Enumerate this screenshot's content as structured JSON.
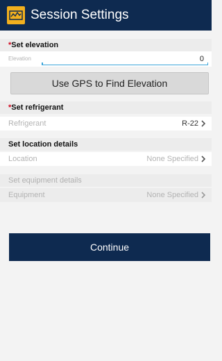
{
  "app": {
    "title": "Session Settings",
    "logo_icon": "app-logo-icon"
  },
  "sections": {
    "elevation": {
      "required_mark": "*",
      "header": "Set elevation",
      "field_label": "Elevation",
      "field_value": "0"
    },
    "gps_button_label": "Use GPS to Find Elevation",
    "refrigerant": {
      "required_mark": "*",
      "header": "Set refrigerant",
      "row_label": "Refrigerant",
      "row_value": "R-22"
    },
    "location": {
      "header": "Set location details",
      "row_label": "Location",
      "row_value": "None Specified"
    },
    "equipment": {
      "header": "Set equipment details",
      "row_label": "Equipment",
      "row_value": "None Specified"
    }
  },
  "continue_label": "Continue",
  "colors": {
    "app_bar": "#0e2a50",
    "accent": "#3aa4d9",
    "required": "#d0021b",
    "logo": "#f2b01e"
  }
}
